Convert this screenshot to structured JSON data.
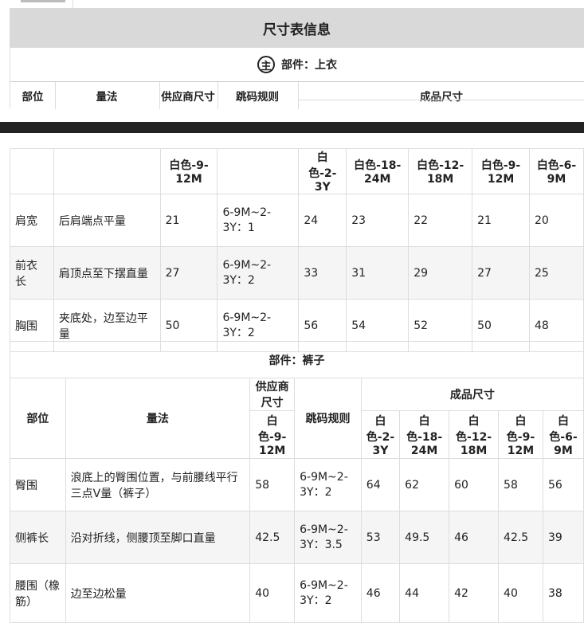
{
  "title": "尺寸表信息",
  "icon_char": "主",
  "top_label": "部件：上衣",
  "top_headers": [
    "部位",
    "量法",
    "供应商尺寸",
    "跳码规则",
    "成品尺寸"
  ],
  "shirt": {
    "headers": [
      "白色-9-12M",
      "白色-2-3Y",
      "白色-18-24M",
      "白色-12-18M",
      "白色-9-12M",
      "白色-6-9M"
    ],
    "rows": [
      {
        "part": "肩宽",
        "method": "后肩端点平量",
        "supplier": "21",
        "rule": "6-9M~2-3Y：1",
        "sizes": [
          "24",
          "23",
          "22",
          "21",
          "20"
        ]
      },
      {
        "part": "前衣长",
        "method": "肩顶点至下摆直量",
        "supplier": "27",
        "rule": "6-9M~2-3Y：2",
        "sizes": [
          "33",
          "31",
          "29",
          "27",
          "25"
        ]
      },
      {
        "part": "胸围",
        "method": "夹底处，边至边平量",
        "supplier": "50",
        "rule": "6-9M~2-3Y：2",
        "sizes": [
          "56",
          "54",
          "52",
          "50",
          "48"
        ]
      }
    ]
  },
  "pants_label": "部件：裤子",
  "pants": {
    "h_part": "部位",
    "h_method": "量法",
    "h_supplier": "供应商尺寸",
    "h_rule": "跳码规则",
    "h_sizes": "成品尺寸",
    "supplier_size": "白色-9-12M",
    "size_headers": [
      "白色-2-3Y",
      "白色-18-24M",
      "白色-12-18M",
      "白色-9-12M",
      "白色-6-9M"
    ],
    "rows": [
      {
        "part": "臀围",
        "method": "浪底上的臀围位置，与前腰线平行三点V量（裤子）",
        "supplier": "58",
        "rule": "6-9M~2-3Y：2",
        "sizes": [
          "64",
          "62",
          "60",
          "58",
          "56"
        ]
      },
      {
        "part": "侧裤长",
        "method": "沿对折线，侧腰顶至脚口直量",
        "supplier": "42.5",
        "rule": "6-9M~2-3Y：3.5",
        "sizes": [
          "53",
          "49.5",
          "46",
          "42.5",
          "39"
        ]
      },
      {
        "part": "腰围（橡筋）",
        "method": "边至边松量",
        "supplier": "40",
        "rule": "6-9M~2-3Y：2",
        "sizes": [
          "46",
          "44",
          "42",
          "40",
          "38"
        ]
      }
    ]
  }
}
